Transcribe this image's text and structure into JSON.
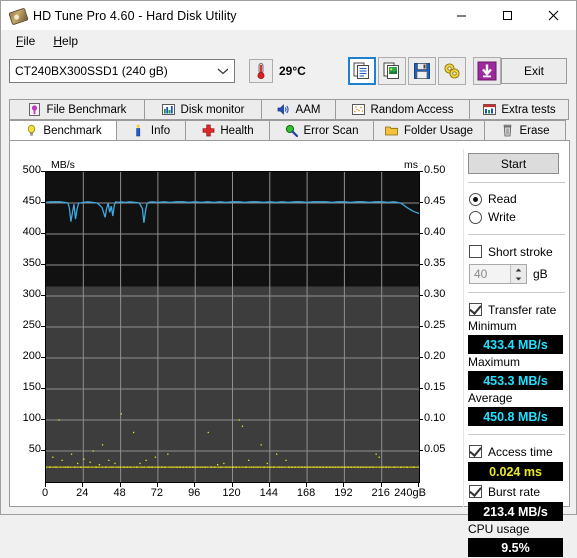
{
  "window": {
    "title": "HD Tune Pro 4.60 - Hard Disk Utility",
    "icon": "harddisk-icon",
    "controls": {
      "minimize": "–",
      "maximize": "□",
      "close": "✕"
    }
  },
  "menu": [
    {
      "label": "File",
      "accel": "F"
    },
    {
      "label": "Help",
      "accel": "H"
    }
  ],
  "toolbar": {
    "drive": {
      "value": "CT240BX300SSD1 (240 gB)",
      "arrow": "chevron-down-icon"
    },
    "temperature": {
      "icon": "thermometer-icon",
      "value": "29°C"
    },
    "buttons": [
      {
        "name": "copy-text-icon",
        "selected": true
      },
      {
        "name": "copy-image-icon",
        "selected": false
      },
      {
        "name": "save-icon",
        "selected": false
      },
      {
        "name": "settings-icon",
        "selected": false
      },
      {
        "name": "download-icon",
        "selected": false
      }
    ],
    "exit_label": "Exit"
  },
  "tabs": {
    "row1": [
      {
        "label": "File Benchmark",
        "icon": "file-benchmark-icon",
        "active": false,
        "width": 136
      },
      {
        "label": "Disk monitor",
        "icon": "disk-monitor-icon",
        "active": false,
        "width": 118
      },
      {
        "label": "AAM",
        "icon": "aam-speaker-icon",
        "active": false,
        "width": 75
      },
      {
        "label": "Random Access",
        "icon": "random-access-icon",
        "active": false,
        "width": 135
      },
      {
        "label": "Extra tests",
        "icon": "extra-tests-icon",
        "active": false,
        "width": 100
      }
    ],
    "row2": [
      {
        "label": "Benchmark",
        "icon": "benchmark-bulb-icon",
        "active": true,
        "width": 108
      },
      {
        "label": "Info",
        "icon": "info-icon",
        "active": false,
        "width": 70
      },
      {
        "label": "Health",
        "icon": "health-cross-icon",
        "active": false,
        "width": 85
      },
      {
        "label": "Error Scan",
        "icon": "error-scan-magnifier-icon",
        "active": false,
        "width": 105
      },
      {
        "label": "Folder Usage",
        "icon": "folder-usage-icon",
        "active": false,
        "width": 112
      },
      {
        "label": "Erase",
        "icon": "erase-trash-icon",
        "active": false,
        "width": 82
      }
    ]
  },
  "panel": {
    "start_label": "Start",
    "mode": {
      "read_label": "Read",
      "write_label": "Write",
      "selected": "Read"
    },
    "short_stroke": {
      "label": "Short stroke",
      "checked": false,
      "value": "40",
      "unit": "gB"
    },
    "transfer_rate": {
      "label": "Transfer rate",
      "checked": true
    },
    "minimum": {
      "label": "Minimum",
      "value": "433.4 MB/s"
    },
    "maximum": {
      "label": "Maximum",
      "value": "453.3 MB/s"
    },
    "average": {
      "label": "Average",
      "value": "450.8 MB/s"
    },
    "access_time": {
      "label": "Access time",
      "checked": true,
      "value": "0.024 ms"
    },
    "burst_rate": {
      "label": "Burst rate",
      "checked": true,
      "value": "213.4 MB/s"
    },
    "cpu_usage": {
      "label": "CPU usage",
      "value": "9.5%"
    }
  },
  "chart_data": {
    "type": "line",
    "title": "",
    "xlabel": "240gB",
    "ylabel": "MB/s",
    "y2label": "ms",
    "grid": true,
    "legend": "none",
    "xlim": [
      0,
      240
    ],
    "ylim": [
      0,
      500
    ],
    "y2lim": [
      0,
      0.5
    ],
    "x_ticks": [
      "0",
      "24",
      "48",
      "72",
      "96",
      "120",
      "144",
      "168",
      "192",
      "216",
      "240gB"
    ],
    "x_tick_values": [
      0,
      24,
      48,
      72,
      96,
      120,
      144,
      168,
      192,
      216,
      240
    ],
    "y_ticks": [
      "500",
      "450",
      "400",
      "350",
      "300",
      "250",
      "200",
      "150",
      "100",
      "50"
    ],
    "y_tick_values": [
      500,
      450,
      400,
      350,
      300,
      250,
      200,
      150,
      100,
      50
    ],
    "y2_ticks": [
      "0.50",
      "0.45",
      "0.40",
      "0.35",
      "0.30",
      "0.25",
      "0.20",
      "0.15",
      "0.10",
      "0.05"
    ],
    "y2_tick_values": [
      0.5,
      0.45,
      0.4,
      0.35,
      0.3,
      0.25,
      0.2,
      0.15,
      0.1,
      0.05
    ],
    "series": [
      {
        "name": "Transfer rate",
        "color": "#3fa9e0",
        "axis": "left",
        "units": "MB/s",
        "x": [
          0,
          3,
          6,
          9,
          12,
          14,
          15,
          16,
          17,
          18,
          19,
          20,
          21,
          22,
          24,
          27,
          30,
          33,
          36,
          38,
          39,
          40,
          41,
          42,
          43,
          44,
          45,
          46,
          47,
          48,
          51,
          54,
          57,
          60,
          62,
          63,
          64,
          65,
          66,
          68,
          72,
          76,
          80,
          84,
          88,
          92,
          96,
          100,
          104,
          108,
          112,
          116,
          120,
          124,
          128,
          132,
          136,
          140,
          144,
          148,
          152,
          156,
          160,
          164,
          168,
          172,
          176,
          180,
          184,
          188,
          192,
          196,
          200,
          204,
          208,
          212,
          216,
          220,
          224,
          228,
          230,
          232,
          234,
          236,
          238,
          240
        ],
        "y": [
          451,
          452,
          452,
          452,
          451,
          450,
          443,
          420,
          434,
          448,
          424,
          440,
          450,
          450,
          451,
          452,
          451,
          450,
          443,
          427,
          441,
          450,
          435,
          445,
          429,
          447,
          452,
          451,
          451,
          452,
          451,
          452,
          451,
          450,
          441,
          418,
          437,
          449,
          451,
          452,
          451,
          452,
          451,
          452,
          452,
          451,
          452,
          451,
          452,
          451,
          452,
          451,
          452,
          452,
          451,
          452,
          452,
          451,
          452,
          451,
          452,
          451,
          452,
          452,
          451,
          452,
          452,
          452,
          451,
          452,
          452,
          451,
          452,
          452,
          451,
          452,
          452,
          451,
          452,
          450,
          447,
          443,
          440,
          437,
          435,
          433
        ]
      },
      {
        "name": "Access time",
        "color": "#f2e61a",
        "axis": "right",
        "units": "ms",
        "style": "scatter",
        "baseline": 0.024,
        "points": [
          [
            2,
            0.024
          ],
          [
            4,
            0.04
          ],
          [
            6,
            0.024
          ],
          [
            8,
            0.1
          ],
          [
            10,
            0.035
          ],
          [
            12,
            0.024
          ],
          [
            14,
            0.024
          ],
          [
            16,
            0.045
          ],
          [
            18,
            0.024
          ],
          [
            20,
            0.03
          ],
          [
            22,
            0.024
          ],
          [
            24,
            0.037
          ],
          [
            26,
            0.024
          ],
          [
            28,
            0.032
          ],
          [
            30,
            0.05
          ],
          [
            32,
            0.024
          ],
          [
            34,
            0.028
          ],
          [
            36,
            0.06
          ],
          [
            38,
            0.024
          ],
          [
            40,
            0.035
          ],
          [
            42,
            0.024
          ],
          [
            44,
            0.03
          ],
          [
            46,
            0.024
          ],
          [
            48,
            0.11
          ],
          [
            50,
            0.024
          ],
          [
            52,
            0.024
          ],
          [
            54,
            0.024
          ],
          [
            56,
            0.08
          ],
          [
            58,
            0.024
          ],
          [
            60,
            0.03
          ],
          [
            62,
            0.024
          ],
          [
            64,
            0.035
          ],
          [
            66,
            0.024
          ],
          [
            68,
            0.024
          ],
          [
            70,
            0.04
          ],
          [
            72,
            0.024
          ],
          [
            74,
            0.024
          ],
          [
            76,
            0.024
          ],
          [
            78,
            0.045
          ],
          [
            80,
            0.024
          ],
          [
            82,
            0.024
          ],
          [
            84,
            0.024
          ],
          [
            86,
            0.024
          ],
          [
            88,
            0.024
          ],
          [
            90,
            0.024
          ],
          [
            92,
            0.024
          ],
          [
            94,
            0.024
          ],
          [
            96,
            0.024
          ],
          [
            98,
            0.024
          ],
          [
            100,
            0.024
          ],
          [
            102,
            0.024
          ],
          [
            104,
            0.08
          ],
          [
            106,
            0.024
          ],
          [
            108,
            0.024
          ],
          [
            110,
            0.028
          ],
          [
            112,
            0.024
          ],
          [
            114,
            0.03
          ],
          [
            116,
            0.024
          ],
          [
            118,
            0.024
          ],
          [
            120,
            0.024
          ],
          [
            122,
            0.024
          ],
          [
            124,
            0.1
          ],
          [
            126,
            0.09
          ],
          [
            128,
            0.024
          ],
          [
            130,
            0.035
          ],
          [
            132,
            0.024
          ],
          [
            134,
            0.024
          ],
          [
            136,
            0.024
          ],
          [
            138,
            0.06
          ],
          [
            140,
            0.024
          ],
          [
            142,
            0.03
          ],
          [
            144,
            0.024
          ],
          [
            146,
            0.024
          ],
          [
            148,
            0.045
          ],
          [
            150,
            0.024
          ],
          [
            152,
            0.024
          ],
          [
            154,
            0.035
          ],
          [
            156,
            0.024
          ],
          [
            158,
            0.024
          ],
          [
            160,
            0.024
          ],
          [
            162,
            0.024
          ],
          [
            164,
            0.024
          ],
          [
            166,
            0.024
          ],
          [
            168,
            0.024
          ],
          [
            170,
            0.024
          ],
          [
            172,
            0.024
          ],
          [
            174,
            0.024
          ],
          [
            176,
            0.024
          ],
          [
            178,
            0.024
          ],
          [
            180,
            0.024
          ],
          [
            182,
            0.024
          ],
          [
            184,
            0.024
          ],
          [
            186,
            0.024
          ],
          [
            188,
            0.024
          ],
          [
            190,
            0.024
          ],
          [
            192,
            0.024
          ],
          [
            194,
            0.024
          ],
          [
            196,
            0.024
          ],
          [
            198,
            0.024
          ],
          [
            200,
            0.024
          ],
          [
            202,
            0.024
          ],
          [
            204,
            0.024
          ],
          [
            206,
            0.024
          ],
          [
            208,
            0.024
          ],
          [
            210,
            0.024
          ],
          [
            212,
            0.045
          ],
          [
            214,
            0.04
          ],
          [
            216,
            0.024
          ],
          [
            218,
            0.024
          ],
          [
            220,
            0.024
          ],
          [
            224,
            0.024
          ],
          [
            228,
            0.024
          ],
          [
            232,
            0.024
          ],
          [
            236,
            0.024
          ],
          [
            240,
            0.024
          ]
        ]
      }
    ]
  }
}
